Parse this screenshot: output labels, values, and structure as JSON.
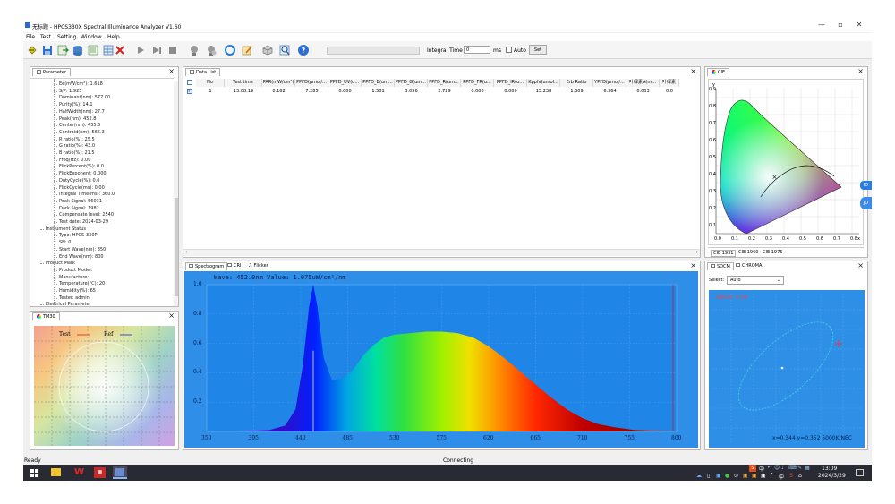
{
  "window": {
    "title": "无标题 - HPCS330X Spectral Illuminance Analyzer V1.60",
    "controls": [
      "—",
      "▫",
      "✕"
    ]
  },
  "menu": [
    "File",
    "Test",
    "Setting",
    "Window",
    "Help"
  ],
  "toolbar": {
    "integral_time_label": "Integral Time",
    "integral_time_value": "0",
    "integral_time_unit": "ms",
    "auto_label": "Auto",
    "set_label": "Set"
  },
  "parameter_panel": {
    "tab": "Parameter",
    "lines": [
      "Ee(mW/cm²): 1.618",
      "S/P: 1.925",
      "Dominant(nm): 577.00",
      "Purity(%): 14.1",
      "HalfWidth(nm): 27.7",
      "Peak(nm): 452.8",
      "Center(nm): 455.5",
      "Centroid(nm): 565.3",
      "R ratio(%): 25.5",
      "G ratio(%): 43.0",
      "B ratio(%): 21.5",
      "Freq(Hz): 0.00",
      "FlickPercent(%): 0.0",
      "FlickExponent: 0.000",
      "DutyCycle(%): 0.0",
      "FlickCycle(ms): 0.00",
      "Integral Time(ms): 360.0",
      "Peak Signal: 56031",
      "Dark Signal: 1982",
      "Compensate level: 2540",
      "Test date: 2024-03-29"
    ],
    "instrument_status": {
      "heading": "Instrument Status",
      "lines": [
        "Type: HPCS-330P",
        "SN: 0",
        "Start Wave(nm): 350",
        "End Wave(nm): 800"
      ]
    },
    "product_mark": {
      "heading": "Product Mark",
      "lines": [
        "Product Model:",
        "Manufacture:",
        "Temperature(°C): 20",
        "Humidity(%): 65",
        "Tester: admin"
      ]
    },
    "electrical": "Electrical Parameter"
  },
  "data_list": {
    "tab": "Data List",
    "columns": [
      "No",
      "Test time",
      "PAR(mW/cm²)",
      "PPFD(μmol/...",
      "PPFD_UV(u...",
      "PPFD_B(um...",
      "PPFD_G(um...",
      "PPFD_R(um...",
      "PPFD_FR(u...",
      "PPFD_IR(u...",
      "Kppfv(umol...",
      "Erb Ratio",
      "YPFD(μmol/...",
      "叶绿素A(m...",
      "叶绿素"
    ],
    "rows": [
      [
        "1",
        "13:08:19",
        "0.162",
        "7.285",
        "0.000",
        "1.501",
        "3.056",
        "2.729",
        "0.000",
        "0.000",
        "15.238",
        "1.309",
        "6.364",
        "0.003",
        "0.0"
      ]
    ]
  },
  "cie_panel": {
    "tab": "CIE",
    "tabs": [
      "CIE 1931",
      "CIE 1960",
      "CIE 1976"
    ],
    "y_label": "y",
    "x_label": "x",
    "point": [
      0.344,
      0.352
    ],
    "x_ticks": [
      "0.0",
      "0.1",
      "0.2",
      "0.3",
      "0.4",
      "0.5",
      "0.6",
      "0.7",
      "0.8"
    ],
    "y_ticks": [
      "0.9",
      "0.8",
      "0.7",
      "0.6",
      "0.5",
      "0.4",
      "0.3",
      "0.2",
      "0.1"
    ]
  },
  "tm30_panel": {
    "tab": "TM30",
    "test_label": "Test",
    "ref_label": "Ref"
  },
  "spectrum_panel": {
    "tabs": [
      "Spectrogram",
      "CRI",
      "Flicker"
    ],
    "readout": "Wave: 452.0nm Value: 1.075uW/cm²/nm",
    "x_ticks": [
      "350",
      "395",
      "440",
      "485",
      "530",
      "575",
      "620",
      "665",
      "710",
      "755",
      "800"
    ],
    "y_ticks": [
      "1.0",
      "0.8",
      "0.6",
      "0.4",
      "0.2"
    ]
  },
  "sdcm_panel": {
    "tabs": [
      "SDCM",
      "CHROMA"
    ],
    "select_label": "Select:",
    "select_value": "Auto",
    "value": "SDCM: 3.56",
    "readout": "x=0.344 y=0.352 5000K/NEC"
  },
  "chart_data": {
    "type": "area",
    "x": [
      350,
      380,
      410,
      425,
      435,
      442,
      448,
      452,
      456,
      462,
      470,
      480,
      490,
      500,
      510,
      520,
      530,
      545,
      560,
      575,
      590,
      605,
      620,
      635,
      650,
      665,
      680,
      695,
      710,
      725,
      740,
      760,
      780,
      800
    ],
    "y": [
      0.0,
      0.0,
      0.01,
      0.04,
      0.15,
      0.45,
      0.85,
      1.0,
      0.85,
      0.5,
      0.35,
      0.36,
      0.42,
      0.52,
      0.59,
      0.64,
      0.66,
      0.67,
      0.68,
      0.68,
      0.67,
      0.64,
      0.58,
      0.5,
      0.41,
      0.32,
      0.23,
      0.15,
      0.09,
      0.05,
      0.03,
      0.01,
      0.005,
      0.0
    ],
    "xlim": [
      350,
      800
    ],
    "ylim": [
      0,
      1.0
    ],
    "marker_nm": 452.0
  },
  "status": {
    "left": "Ready",
    "center": "Connecting"
  },
  "taskbar": {
    "time": "13:09",
    "date": "2024/3/29",
    "ime": "中"
  },
  "colors": {
    "spectrum_bg": "#2f8ee8",
    "sdcm_bg": "#2e8fe6",
    "sdcm_text": "#ff4040",
    "taskbar": "#2a2a34"
  }
}
